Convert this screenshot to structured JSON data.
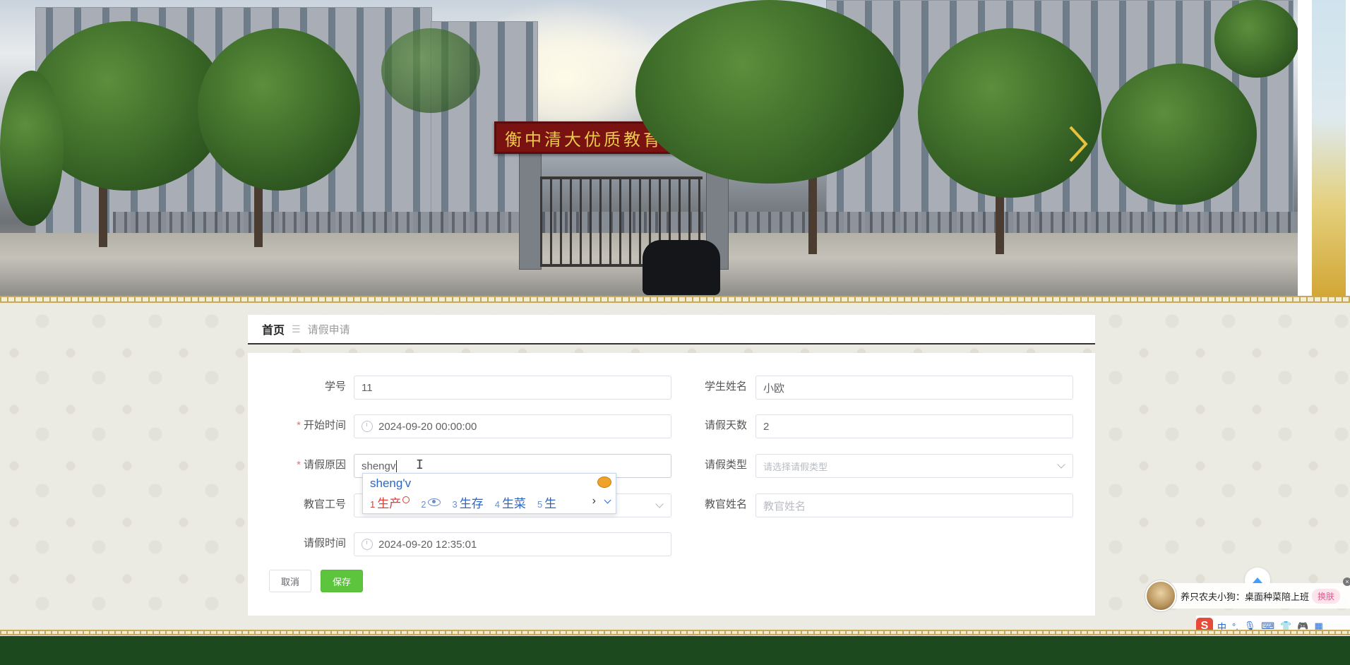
{
  "breadcrumb": {
    "home": "首页",
    "separator": "☰",
    "current": "请假申请"
  },
  "form": {
    "student_no": {
      "label": "学号",
      "value": "11"
    },
    "student_name": {
      "label": "学生姓名",
      "value": "小欧"
    },
    "start_time": {
      "label": "开始时间",
      "value": "2024-09-20 00:00:00",
      "required": "*"
    },
    "leave_days": {
      "label": "请假天数",
      "value": "2"
    },
    "reason": {
      "label": "请假原因",
      "value": "shengv",
      "required": "*"
    },
    "leave_type": {
      "label": "请假类型",
      "placeholder": "请选择请假类型"
    },
    "teacher_no": {
      "label": "教官工号"
    },
    "teacher_name": {
      "label": "教官姓名",
      "placeholder": "教官姓名"
    },
    "leave_time": {
      "label": "请假时间",
      "value": "2024-09-20 12:35:01"
    }
  },
  "buttons": {
    "cancel": "取消",
    "save": "保存"
  },
  "ime": {
    "composition": "sheng'v",
    "candidates": [
      {
        "num": "1",
        "text": "生产"
      },
      {
        "num": "2",
        "text": ""
      },
      {
        "num": "3",
        "text": "生存"
      },
      {
        "num": "4",
        "text": "生菜"
      },
      {
        "num": "5",
        "text": "生"
      }
    ],
    "more": "›"
  },
  "banner": {
    "gate_sign": "衡中清大优质教育示范基地"
  },
  "ticker": {
    "text": "养只农夫小狗：桌面种菜陪上班",
    "button": "换肤"
  },
  "imebar": {
    "logo": "S",
    "mode": "中"
  },
  "colors": {
    "save_green": "#5cc43d",
    "footer_green": "#1c4a1e",
    "ime_blue": "#2a66c9"
  }
}
